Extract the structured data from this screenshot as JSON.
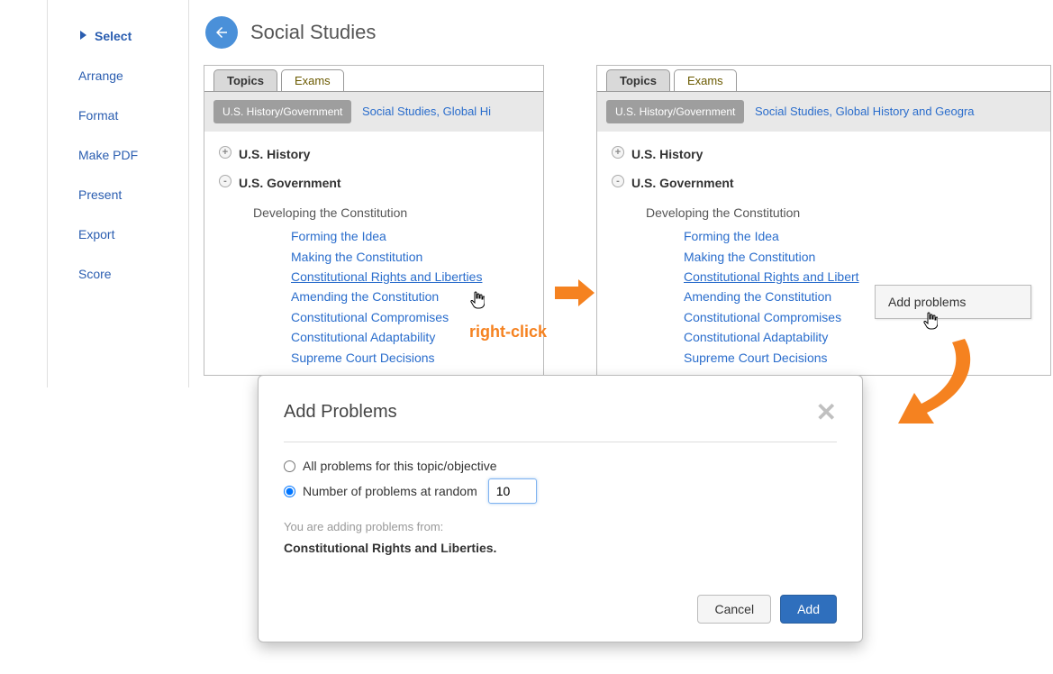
{
  "sidebar": {
    "items": [
      {
        "label": "Select",
        "active": true
      },
      {
        "label": "Arrange",
        "active": false
      },
      {
        "label": "Format",
        "active": false
      },
      {
        "label": "Make PDF",
        "active": false
      },
      {
        "label": "Present",
        "active": false
      },
      {
        "label": "Export",
        "active": false
      },
      {
        "label": "Score",
        "active": false
      }
    ]
  },
  "header": {
    "title": "Social Studies"
  },
  "panels": {
    "tabs": {
      "topics": "Topics",
      "exams": "Exams"
    },
    "subject_pill": "U.S. History/Government",
    "subject_link_short": "Social Studies, Global Hi",
    "subject_link_long": "Social Studies, Global History and Geogra",
    "history_root": "U.S. History",
    "gov_root": "U.S. Government",
    "gov_sub": "Developing the Constitution",
    "gov_links": [
      "Forming the Idea",
      "Making the Constitution",
      "Constitutional Rights and Liberties",
      "Amending the Constitution",
      "Constitutional Compromises",
      "Constitutional Adaptability",
      "Supreme Court Decisions"
    ],
    "gov_link_right_truncated": "Constitutional Rights and Libert"
  },
  "annotations": {
    "right_click": "right-click"
  },
  "context_menu": {
    "label": "Add problems"
  },
  "dialog": {
    "title": "Add Problems",
    "radio_all": "All problems for this topic/objective",
    "radio_random": "Number of problems at random",
    "random_value": "10",
    "hint": "You are adding problems from:",
    "topic": "Constitutional Rights and Liberties.",
    "btn_cancel": "Cancel",
    "btn_add": "Add"
  }
}
